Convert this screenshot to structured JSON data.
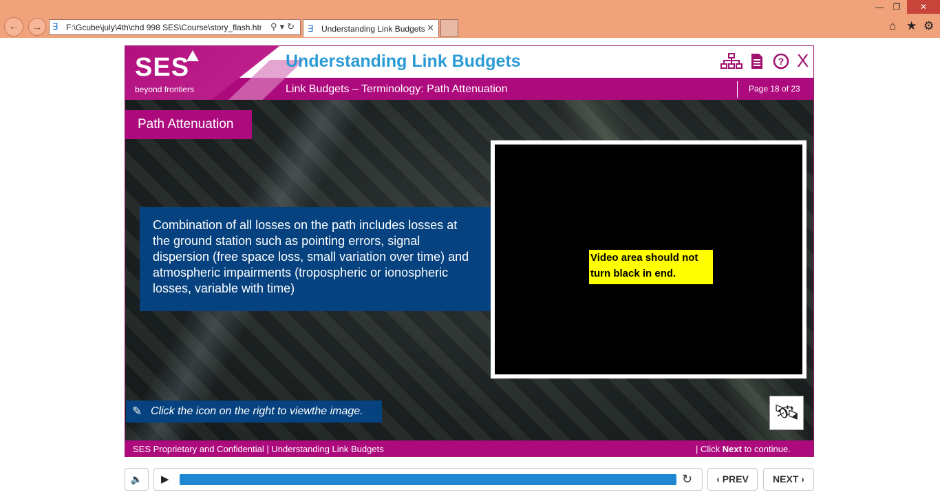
{
  "browser": {
    "address": "F:\\Gcube\\july\\4th\\chd 998 SES\\Course\\story_flash.htm",
    "tab_title": "Understanding Link Budgets",
    "icons": {
      "back": "back-arrow-icon",
      "forward": "forward-arrow-icon",
      "search": "search-icon",
      "refresh": "refresh-icon",
      "home": "home-icon",
      "favorites": "star-icon",
      "settings": "gear-icon"
    }
  },
  "header": {
    "logo_text": "SES",
    "logo_tagline": "beyond frontiers",
    "course_title": "Understanding Link Budgets",
    "sub_title": "Link Budgets – Terminology: Path Attenuation",
    "page_indicator": "Page 18 of 23",
    "icons": [
      "sitemap-icon",
      "document-icon",
      "help-icon",
      "close-icon"
    ]
  },
  "content": {
    "section_label": "Path Attenuation",
    "body_text": "Combination of all losses on the path includes losses at the ground station such as pointing errors, signal dispersion (free space loss, small variation over time) and atmospheric impairments (tropospheric or ionospheric losses, variable with time)",
    "video_note": "Video area should not turn black in end.",
    "hint_text": "Click the icon on the right to viewthe image.",
    "hint_icon": "pointer-hand-icon",
    "image_button_icon": "satellite-icon"
  },
  "footer": {
    "left": "SES Proprietary and Confidential | Understanding Link Budgets",
    "right_prefix": "|  Click ",
    "right_bold": "Next",
    "right_suffix": " to continue."
  },
  "player": {
    "progress": 1.0,
    "prev_label": "PREV",
    "next_label": "NEXT",
    "icons": [
      "volume-icon",
      "play-icon",
      "replay-icon",
      "chevron-left-icon",
      "chevron-right-icon"
    ]
  },
  "colors": {
    "brand_magenta": "#ad0a7d",
    "title_blue": "#2b9bd6",
    "text_box_blue": "#05427f",
    "progress_blue": "#1f86d1",
    "note_yellow": "#ffff00",
    "chrome": "#f0a27b"
  }
}
